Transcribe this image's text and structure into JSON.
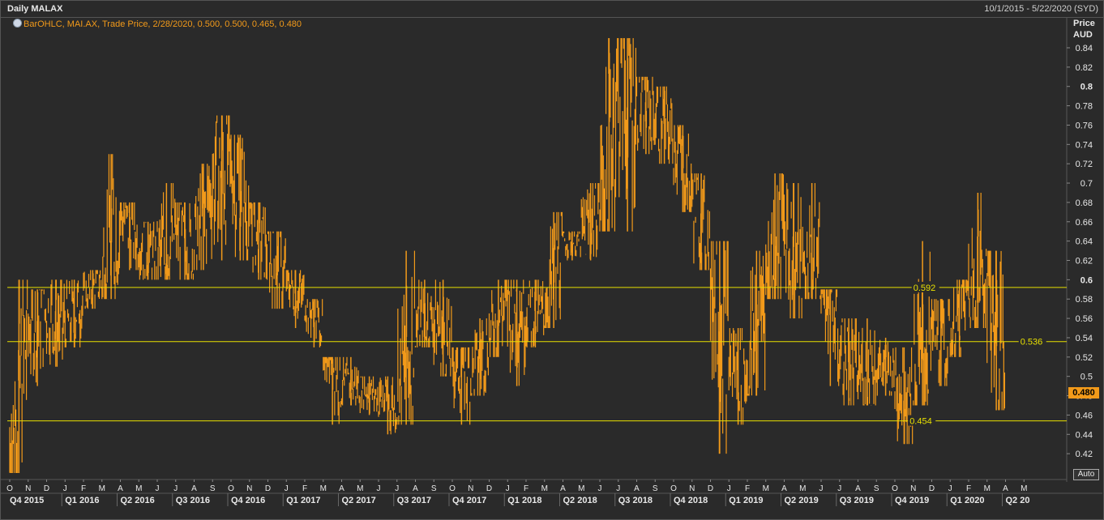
{
  "header": {
    "title": "Daily MALAX",
    "date_range": "10/1/2015 - 5/22/2020 (SYD)"
  },
  "legend": {
    "text": "BarOHLC, MAI.AX, Trade Price, 2/28/2020, 0.500, 0.500, 0.465, 0.480",
    "icon": "clock-icon"
  },
  "axis": {
    "price_label": "Price",
    "currency_label": "AUD",
    "auto_label": "Auto"
  },
  "last_price": "0.480",
  "colors": {
    "background": "#2a2a2a",
    "series": "#f29a1a",
    "reference_line": "#e8e000",
    "text": "#e8e8e8"
  },
  "chart_data": {
    "type": "bar",
    "title": "Daily MALAX",
    "ylim": [
      0.4,
      0.85
    ],
    "yticks": [
      "0.84",
      "0.82",
      "0.8",
      "0.78",
      "0.76",
      "0.74",
      "0.72",
      "0.7",
      "0.68",
      "0.66",
      "0.64",
      "0.62",
      "0.6",
      "0.58",
      "0.56",
      "0.54",
      "0.52",
      "0.5",
      "0.48",
      "0.46",
      "0.44",
      "0.42"
    ],
    "bold_yticks": [
      "0.8",
      "0.6"
    ],
    "month_labels": [
      "O",
      "N",
      "D",
      "J",
      "F",
      "M",
      "A",
      "M",
      "J",
      "J",
      "A",
      "S",
      "O",
      "N",
      "D",
      "J",
      "F",
      "M",
      "A",
      "M",
      "J",
      "J",
      "A",
      "S",
      "O",
      "N",
      "D",
      "J",
      "F",
      "M",
      "A",
      "M",
      "J",
      "J",
      "A",
      "S",
      "O",
      "N",
      "D",
      "J",
      "F",
      "M",
      "A",
      "M",
      "J",
      "J",
      "A",
      "S",
      "O",
      "N",
      "D",
      "J",
      "F",
      "M",
      "A",
      "M"
    ],
    "quarter_labels": [
      "Q4 2015",
      "Q1 2016",
      "Q2 2016",
      "Q3 2016",
      "Q4 2016",
      "Q1 2017",
      "Q2 2017",
      "Q3 2017",
      "Q4 2017",
      "Q1 2018",
      "Q2 2018",
      "Q3 2018",
      "Q4 2018",
      "Q1 2019",
      "Q2 2019",
      "Q3 2019",
      "Q4 2019",
      "Q1 2020",
      "Q2 20"
    ],
    "reference_lines": [
      {
        "value": 0.592,
        "label": "0.592",
        "label_month_index": 49
      },
      {
        "value": 0.536,
        "label": "0.536",
        "label_month_index": 54.8
      },
      {
        "value": 0.454,
        "label": "0.454",
        "label_month_index": 48.8
      }
    ],
    "series_monthly": [
      {
        "month": "2015-10",
        "open": 0.41,
        "high": 0.6,
        "low": 0.4,
        "close": 0.55
      },
      {
        "month": "2015-11",
        "open": 0.55,
        "high": 0.59,
        "low": 0.49,
        "close": 0.57
      },
      {
        "month": "2015-12",
        "open": 0.57,
        "high": 0.6,
        "low": 0.51,
        "close": 0.55
      },
      {
        "month": "2016-01",
        "open": 0.55,
        "high": 0.6,
        "low": 0.53,
        "close": 0.58
      },
      {
        "month": "2016-02",
        "open": 0.58,
        "high": 0.61,
        "low": 0.57,
        "close": 0.6
      },
      {
        "month": "2016-03",
        "open": 0.6,
        "high": 0.73,
        "low": 0.58,
        "close": 0.67
      },
      {
        "month": "2016-04",
        "open": 0.67,
        "high": 0.68,
        "low": 0.61,
        "close": 0.64
      },
      {
        "month": "2016-05",
        "open": 0.64,
        "high": 0.66,
        "low": 0.6,
        "close": 0.62
      },
      {
        "month": "2016-06",
        "open": 0.62,
        "high": 0.7,
        "low": 0.6,
        "close": 0.65
      },
      {
        "month": "2016-07",
        "open": 0.65,
        "high": 0.68,
        "low": 0.6,
        "close": 0.63
      },
      {
        "month": "2016-08",
        "open": 0.63,
        "high": 0.72,
        "low": 0.61,
        "close": 0.7
      },
      {
        "month": "2016-09",
        "open": 0.7,
        "high": 0.77,
        "low": 0.62,
        "close": 0.72
      },
      {
        "month": "2016-10",
        "open": 0.72,
        "high": 0.75,
        "low": 0.62,
        "close": 0.66
      },
      {
        "month": "2016-11",
        "open": 0.66,
        "high": 0.68,
        "low": 0.6,
        "close": 0.63
      },
      {
        "month": "2016-12",
        "open": 0.63,
        "high": 0.65,
        "low": 0.57,
        "close": 0.6
      },
      {
        "month": "2017-01",
        "open": 0.6,
        "high": 0.61,
        "low": 0.55,
        "close": 0.58
      },
      {
        "month": "2017-02",
        "open": 0.58,
        "high": 0.58,
        "low": 0.53,
        "close": 0.55
      },
      {
        "month": "2017-03",
        "open": 0.55,
        "high": 0.52,
        "low": 0.45,
        "close": 0.49
      },
      {
        "month": "2017-04",
        "open": 0.49,
        "high": 0.52,
        "low": 0.47,
        "close": 0.49
      },
      {
        "month": "2017-05",
        "open": 0.49,
        "high": 0.5,
        "low": 0.46,
        "close": 0.48
      },
      {
        "month": "2017-06",
        "open": 0.48,
        "high": 0.5,
        "low": 0.44,
        "close": 0.47
      },
      {
        "month": "2017-07",
        "open": 0.47,
        "high": 0.63,
        "low": 0.45,
        "close": 0.55
      },
      {
        "month": "2017-08",
        "open": 0.55,
        "high": 0.6,
        "low": 0.53,
        "close": 0.56
      },
      {
        "month": "2017-09",
        "open": 0.56,
        "high": 0.6,
        "low": 0.5,
        "close": 0.52
      },
      {
        "month": "2017-10",
        "open": 0.52,
        "high": 0.53,
        "low": 0.45,
        "close": 0.5
      },
      {
        "month": "2017-11",
        "open": 0.5,
        "high": 0.56,
        "low": 0.48,
        "close": 0.54
      },
      {
        "month": "2017-12",
        "open": 0.54,
        "high": 0.6,
        "low": 0.52,
        "close": 0.58
      },
      {
        "month": "2018-01",
        "open": 0.58,
        "high": 0.6,
        "low": 0.49,
        "close": 0.57
      },
      {
        "month": "2018-02",
        "open": 0.57,
        "high": 0.6,
        "low": 0.53,
        "close": 0.56
      },
      {
        "month": "2018-03",
        "open": 0.56,
        "high": 0.67,
        "low": 0.55,
        "close": 0.64
      },
      {
        "month": "2018-04",
        "open": 0.64,
        "high": 0.65,
        "low": 0.62,
        "close": 0.64
      },
      {
        "month": "2018-05",
        "open": 0.64,
        "high": 0.7,
        "low": 0.62,
        "close": 0.68
      },
      {
        "month": "2018-06",
        "open": 0.68,
        "high": 0.85,
        "low": 0.65,
        "close": 0.8
      },
      {
        "month": "2018-07",
        "open": 0.8,
        "high": 0.85,
        "low": 0.65,
        "close": 0.78
      },
      {
        "month": "2018-08",
        "open": 0.78,
        "high": 0.81,
        "low": 0.73,
        "close": 0.77
      },
      {
        "month": "2018-09",
        "open": 0.77,
        "high": 0.8,
        "low": 0.72,
        "close": 0.75
      },
      {
        "month": "2018-10",
        "open": 0.75,
        "high": 0.76,
        "low": 0.67,
        "close": 0.69
      },
      {
        "month": "2018-11",
        "open": 0.69,
        "high": 0.71,
        "low": 0.61,
        "close": 0.63
      },
      {
        "month": "2018-12",
        "open": 0.63,
        "high": 0.64,
        "low": 0.42,
        "close": 0.52
      },
      {
        "month": "2019-01",
        "open": 0.52,
        "high": 0.55,
        "low": 0.45,
        "close": 0.5
      },
      {
        "month": "2019-02",
        "open": 0.5,
        "high": 0.63,
        "low": 0.48,
        "close": 0.6
      },
      {
        "month": "2019-03",
        "open": 0.6,
        "high": 0.71,
        "low": 0.58,
        "close": 0.66
      },
      {
        "month": "2019-04",
        "open": 0.66,
        "high": 0.7,
        "low": 0.56,
        "close": 0.6
      },
      {
        "month": "2019-05",
        "open": 0.6,
        "high": 0.7,
        "low": 0.58,
        "close": 0.63
      },
      {
        "month": "2019-06",
        "open": 0.63,
        "high": 0.59,
        "low": 0.49,
        "close": 0.53
      },
      {
        "month": "2019-07",
        "open": 0.53,
        "high": 0.56,
        "low": 0.47,
        "close": 0.5
      },
      {
        "month": "2019-08",
        "open": 0.5,
        "high": 0.56,
        "low": 0.47,
        "close": 0.51
      },
      {
        "month": "2019-09",
        "open": 0.51,
        "high": 0.54,
        "low": 0.48,
        "close": 0.5
      },
      {
        "month": "2019-10",
        "open": 0.5,
        "high": 0.53,
        "low": 0.43,
        "close": 0.48
      },
      {
        "month": "2019-11",
        "open": 0.48,
        "high": 0.64,
        "low": 0.47,
        "close": 0.55
      },
      {
        "month": "2019-12",
        "open": 0.55,
        "high": 0.58,
        "low": 0.49,
        "close": 0.53
      },
      {
        "month": "2020-01",
        "open": 0.53,
        "high": 0.6,
        "low": 0.52,
        "close": 0.59
      },
      {
        "month": "2020-02",
        "open": 0.59,
        "high": 0.69,
        "low": 0.55,
        "close": 0.62
      },
      {
        "month": "2020-03",
        "open": 0.62,
        "high": 0.63,
        "low": 0.465,
        "close": 0.48
      }
    ]
  }
}
